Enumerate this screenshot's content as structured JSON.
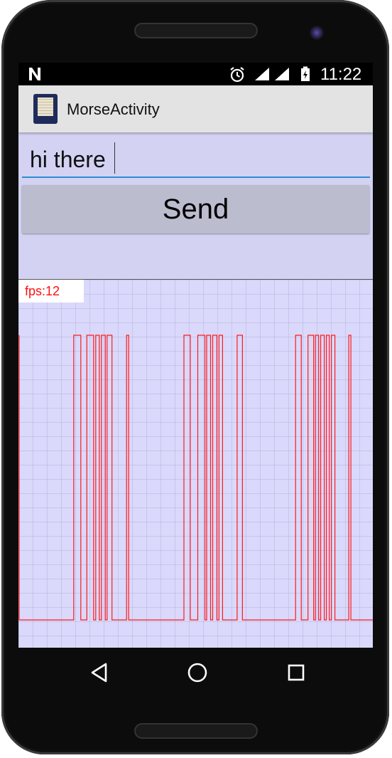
{
  "status_bar": {
    "time": "11:22",
    "icons": [
      "n-notification-icon",
      "alarm-icon",
      "wifi-signal-icon",
      "cell-signal-icon",
      "battery-icon"
    ]
  },
  "app_bar": {
    "title": "MorseActivity",
    "launcher_icon": "app-launcher-icon"
  },
  "message_input": {
    "value": "hi there"
  },
  "send_button": {
    "label": "Send"
  },
  "signal_view": {
    "fps_label": "fps:12",
    "signal_color": "#ff1a1a",
    "background_color": "#dad9fb",
    "levels": [
      "low",
      "high"
    ],
    "pulses": [
      [
        0.156,
        0.176
      ],
      [
        0.193,
        0.212
      ],
      [
        0.218,
        0.228
      ],
      [
        0.234,
        0.245
      ],
      [
        0.25,
        0.264
      ],
      [
        0.305,
        0.311
      ],
      [
        0.467,
        0.485
      ],
      [
        0.506,
        0.526
      ],
      [
        0.531,
        0.542
      ],
      [
        0.548,
        0.56
      ],
      [
        0.566,
        0.576
      ],
      [
        0.617,
        0.632
      ],
      [
        0.782,
        0.798
      ],
      [
        0.817,
        0.833
      ],
      [
        0.838,
        0.847
      ],
      [
        0.853,
        0.863
      ],
      [
        0.869,
        0.877
      ],
      [
        0.883,
        0.893
      ],
      [
        0.932,
        0.938
      ]
    ],
    "initial_spike": true
  },
  "nav_bar": {
    "back": "back-icon",
    "home": "home-icon",
    "recents": "recents-icon"
  },
  "theme": {
    "accent": "#2a8fd0",
    "screen_bg": "#d3d2f2",
    "button_bg": "#bcbccf"
  }
}
